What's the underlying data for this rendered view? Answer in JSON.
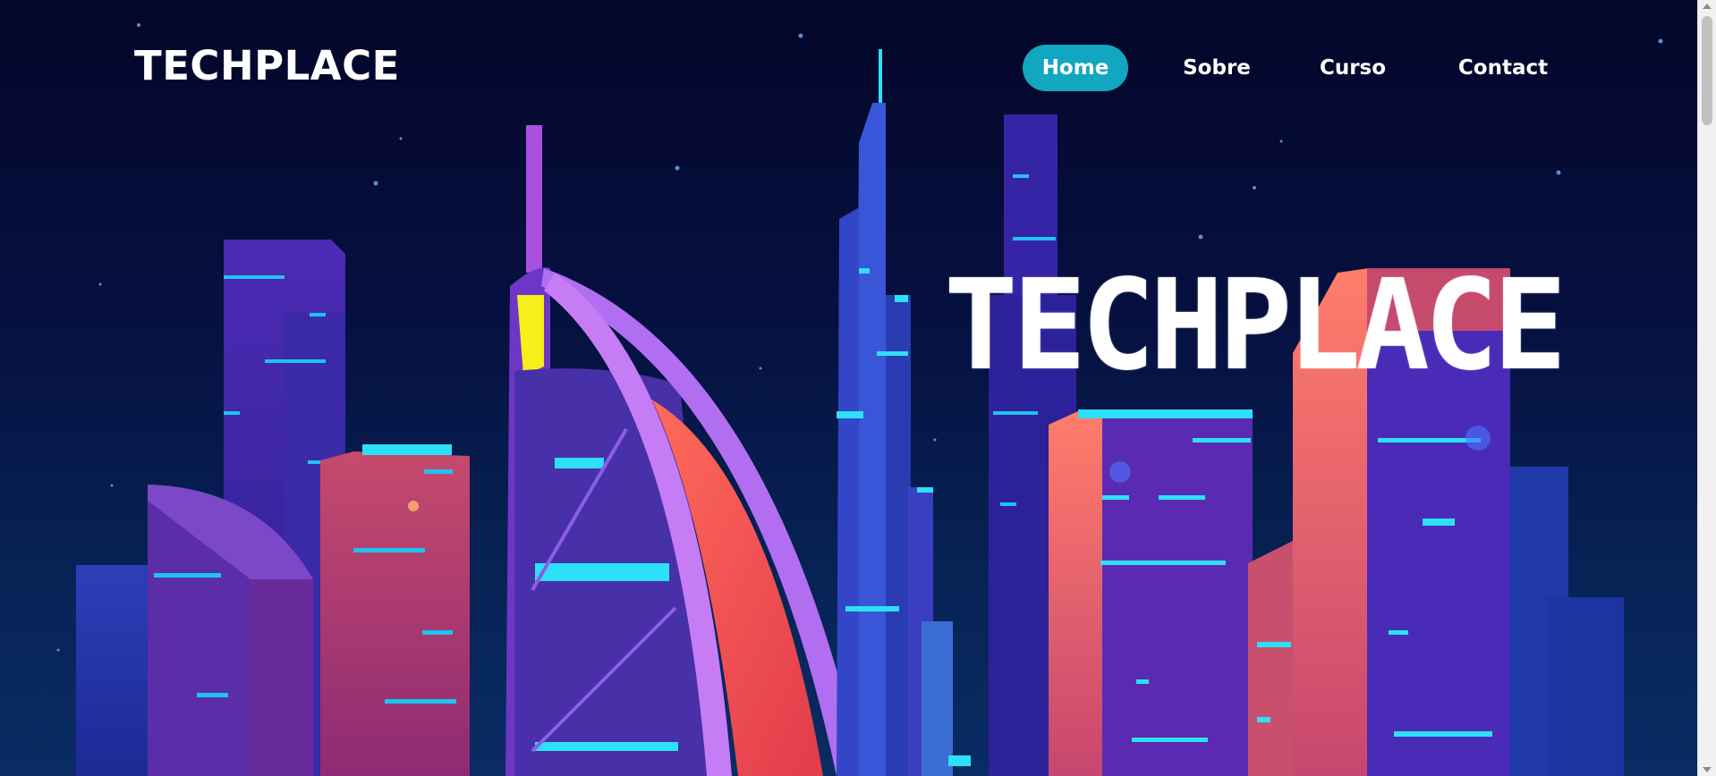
{
  "brand": {
    "logo_text": "TECHPLACE"
  },
  "nav": {
    "items": [
      {
        "label": "Home",
        "active": true
      },
      {
        "label": "Sobre",
        "active": false
      },
      {
        "label": "Curso",
        "active": false
      },
      {
        "label": "Contact",
        "active": false
      }
    ]
  },
  "hero": {
    "headline": "TECHPLACE",
    "illustration": "neon-city-skyline-illustration"
  },
  "colors": {
    "nav_active_bg": "#12a7c0",
    "background": "#040629",
    "neon_cyan": "#19d3f2",
    "neon_pink": "#e8506f",
    "neon_purple": "#7a3cd6"
  }
}
